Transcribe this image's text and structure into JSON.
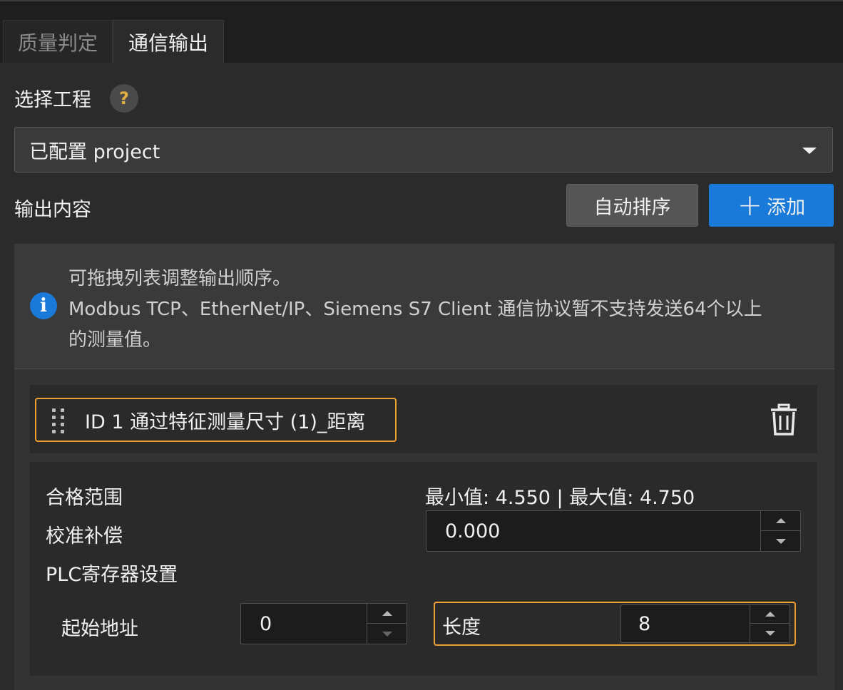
{
  "tabs": [
    {
      "label": "质量判定",
      "active": false
    },
    {
      "label": "通信输出",
      "active": true
    }
  ],
  "project": {
    "label": "选择工程",
    "help_icon": "?",
    "selected": "已配置 project"
  },
  "output": {
    "label": "输出内容",
    "auto_sort_label": "自动排序",
    "add_label": "添加"
  },
  "info": {
    "icon": "i",
    "lines": [
      "可拖拽列表调整输出顺序。",
      "Modbus TCP、EtherNet/IP、Siemens S7 Client 通信协议暂不支持发送64个以上",
      "的测量值。"
    ]
  },
  "item": {
    "title": "ID 1  通过特征测量尺寸 (1)_距离",
    "range_label": "合格范围",
    "range_text": "最小值: 4.550 | 最大值: 4.750",
    "calibration_label": "校准补偿",
    "calibration_value": "0.000",
    "plc_label": "PLC寄存器设置",
    "start_address_label": "起始地址",
    "start_address_value": "0",
    "length_label": "长度",
    "length_value": "8"
  },
  "colors": {
    "accent": "#1a7ad9",
    "highlight": "#f0a030",
    "background": "#2b2b2b"
  },
  "icons": {
    "help": "help-icon",
    "dropdown": "chevron-down-icon",
    "plus": "plus-icon",
    "info": "info-icon",
    "drag": "drag-handle-icon",
    "trash": "trash-icon"
  }
}
